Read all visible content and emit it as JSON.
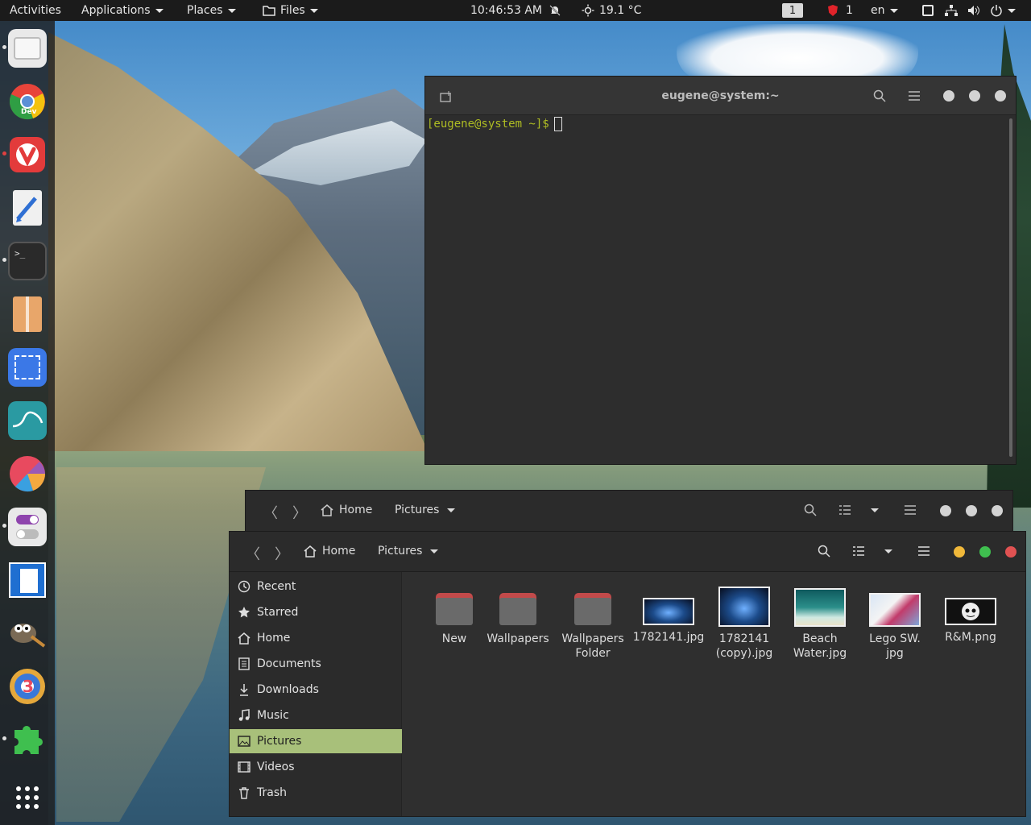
{
  "topbar": {
    "activities": "Activities",
    "applications": "Applications",
    "places": "Places",
    "files": "Files",
    "clock": "10:46:53 AM",
    "weather": "19.1 °C",
    "workspace": "1",
    "security_count": "1",
    "language": "en"
  },
  "dock": {
    "apps": [
      {
        "name": "files-icon"
      },
      {
        "name": "chrome-dev-icon",
        "label": "Dev"
      },
      {
        "name": "vivaldi-icon"
      },
      {
        "name": "text-editor-icon"
      },
      {
        "name": "terminal-icon"
      },
      {
        "name": "archive-manager-icon"
      },
      {
        "name": "screenshot-icon"
      },
      {
        "name": "system-monitor-icon"
      },
      {
        "name": "disk-usage-icon"
      },
      {
        "name": "tweaks-icon"
      },
      {
        "name": "document-viewer-icon"
      },
      {
        "name": "gimp-icon"
      },
      {
        "name": "blender-icon"
      },
      {
        "name": "extensions-icon"
      },
      {
        "name": "app-grid-icon"
      }
    ]
  },
  "terminal": {
    "title": "eugene@system:~",
    "prompt": "[eugene@system ~]$"
  },
  "files_back": {
    "home": "Home",
    "current": "Pictures"
  },
  "files": {
    "home": "Home",
    "current": "Pictures",
    "sidebar": [
      {
        "label": "Recent",
        "icon": "clock-icon"
      },
      {
        "label": "Starred",
        "icon": "star-icon"
      },
      {
        "label": "Home",
        "icon": "home-icon"
      },
      {
        "label": "Documents",
        "icon": "document-icon"
      },
      {
        "label": "Downloads",
        "icon": "download-icon"
      },
      {
        "label": "Music",
        "icon": "music-icon"
      },
      {
        "label": "Pictures",
        "icon": "picture-icon"
      },
      {
        "label": "Videos",
        "icon": "video-icon"
      },
      {
        "label": "Trash",
        "icon": "trash-icon"
      }
    ],
    "items": [
      {
        "line1": "New",
        "line2": "",
        "type": "folder"
      },
      {
        "line1": "Wallpapers",
        "line2": "",
        "type": "folder"
      },
      {
        "line1": "Wallpapers",
        "line2": "Folder",
        "type": "folder"
      },
      {
        "line1": "1782141.jpg",
        "line2": "",
        "type": "image"
      },
      {
        "line1": "1782141",
        "line2": "(copy).jpg",
        "type": "image"
      },
      {
        "line1": "Beach",
        "line2": "Water.jpg",
        "type": "image"
      },
      {
        "line1": "Lego SW.",
        "line2": "jpg",
        "type": "image"
      },
      {
        "line1": "R&M.png",
        "line2": "",
        "type": "image"
      }
    ]
  },
  "colors": {
    "accent": "#a8c07a",
    "prompt": "#aebc23",
    "close": "#e05252",
    "maximize": "#3fbf4f",
    "minimize": "#f0b83a"
  }
}
